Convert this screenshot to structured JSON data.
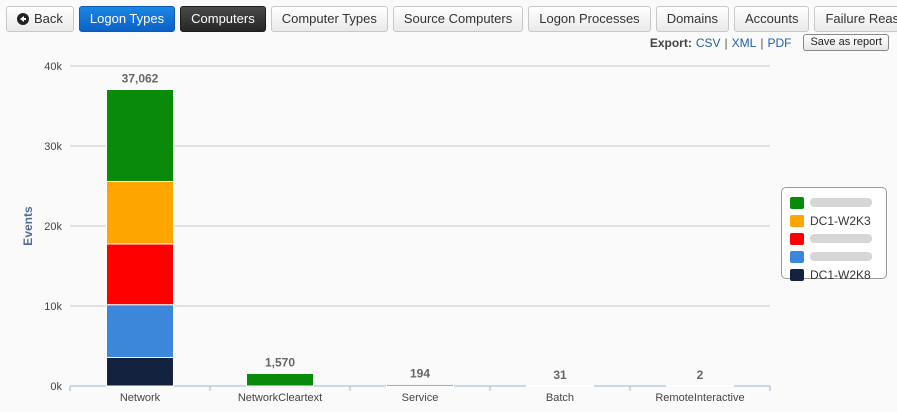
{
  "toolbar": {
    "back_label": "Back",
    "tabs": [
      {
        "label": "Logon Types",
        "style": "primary"
      },
      {
        "label": "Computers",
        "style": "dark"
      },
      {
        "label": "Computer Types",
        "style": "normal"
      },
      {
        "label": "Source Computers",
        "style": "normal"
      },
      {
        "label": "Logon Processes",
        "style": "normal"
      },
      {
        "label": "Domains",
        "style": "normal"
      },
      {
        "label": "Accounts",
        "style": "normal"
      },
      {
        "label": "Failure Reasons",
        "style": "normal"
      }
    ]
  },
  "export": {
    "label": "Export:",
    "csv": "CSV",
    "xml": "XML",
    "pdf": "PDF",
    "sep": "|",
    "save_label": "Save as report"
  },
  "chart_data": {
    "type": "bar",
    "stacked": true,
    "categories": [
      "Network",
      "NetworkCleartext",
      "Service",
      "Batch",
      "RemoteInteractive"
    ],
    "series": [
      {
        "name": "",
        "redacted": true,
        "color": "#0a8a0a",
        "values": [
          11500,
          1570,
          194,
          31,
          2
        ]
      },
      {
        "name": "DC1-W2K3",
        "color": "#ffa500",
        "values": [
          7800,
          0,
          0,
          0,
          0
        ]
      },
      {
        "name": "",
        "redacted": true,
        "color": "#ff0000",
        "values": [
          7600,
          0,
          0,
          0,
          0
        ]
      },
      {
        "name": "",
        "redacted": true,
        "color": "#3c87d9",
        "values": [
          6600,
          0,
          0,
          0,
          0
        ]
      },
      {
        "name": "DC1-W2K8",
        "color": "#13233f",
        "values": [
          3562,
          0,
          0,
          0,
          0
        ]
      }
    ],
    "totals": [
      "37,062",
      "1,570",
      "194",
      "31",
      "2"
    ],
    "ylabel": "Events",
    "ylim": [
      0,
      40000
    ],
    "yticks": [
      {
        "value": 0,
        "label": "0k"
      },
      {
        "value": 10000,
        "label": "10k"
      },
      {
        "value": 20000,
        "label": "20k"
      },
      {
        "value": 30000,
        "label": "30k"
      },
      {
        "value": 40000,
        "label": "40k"
      }
    ],
    "grid": true,
    "legend_position": "right"
  }
}
